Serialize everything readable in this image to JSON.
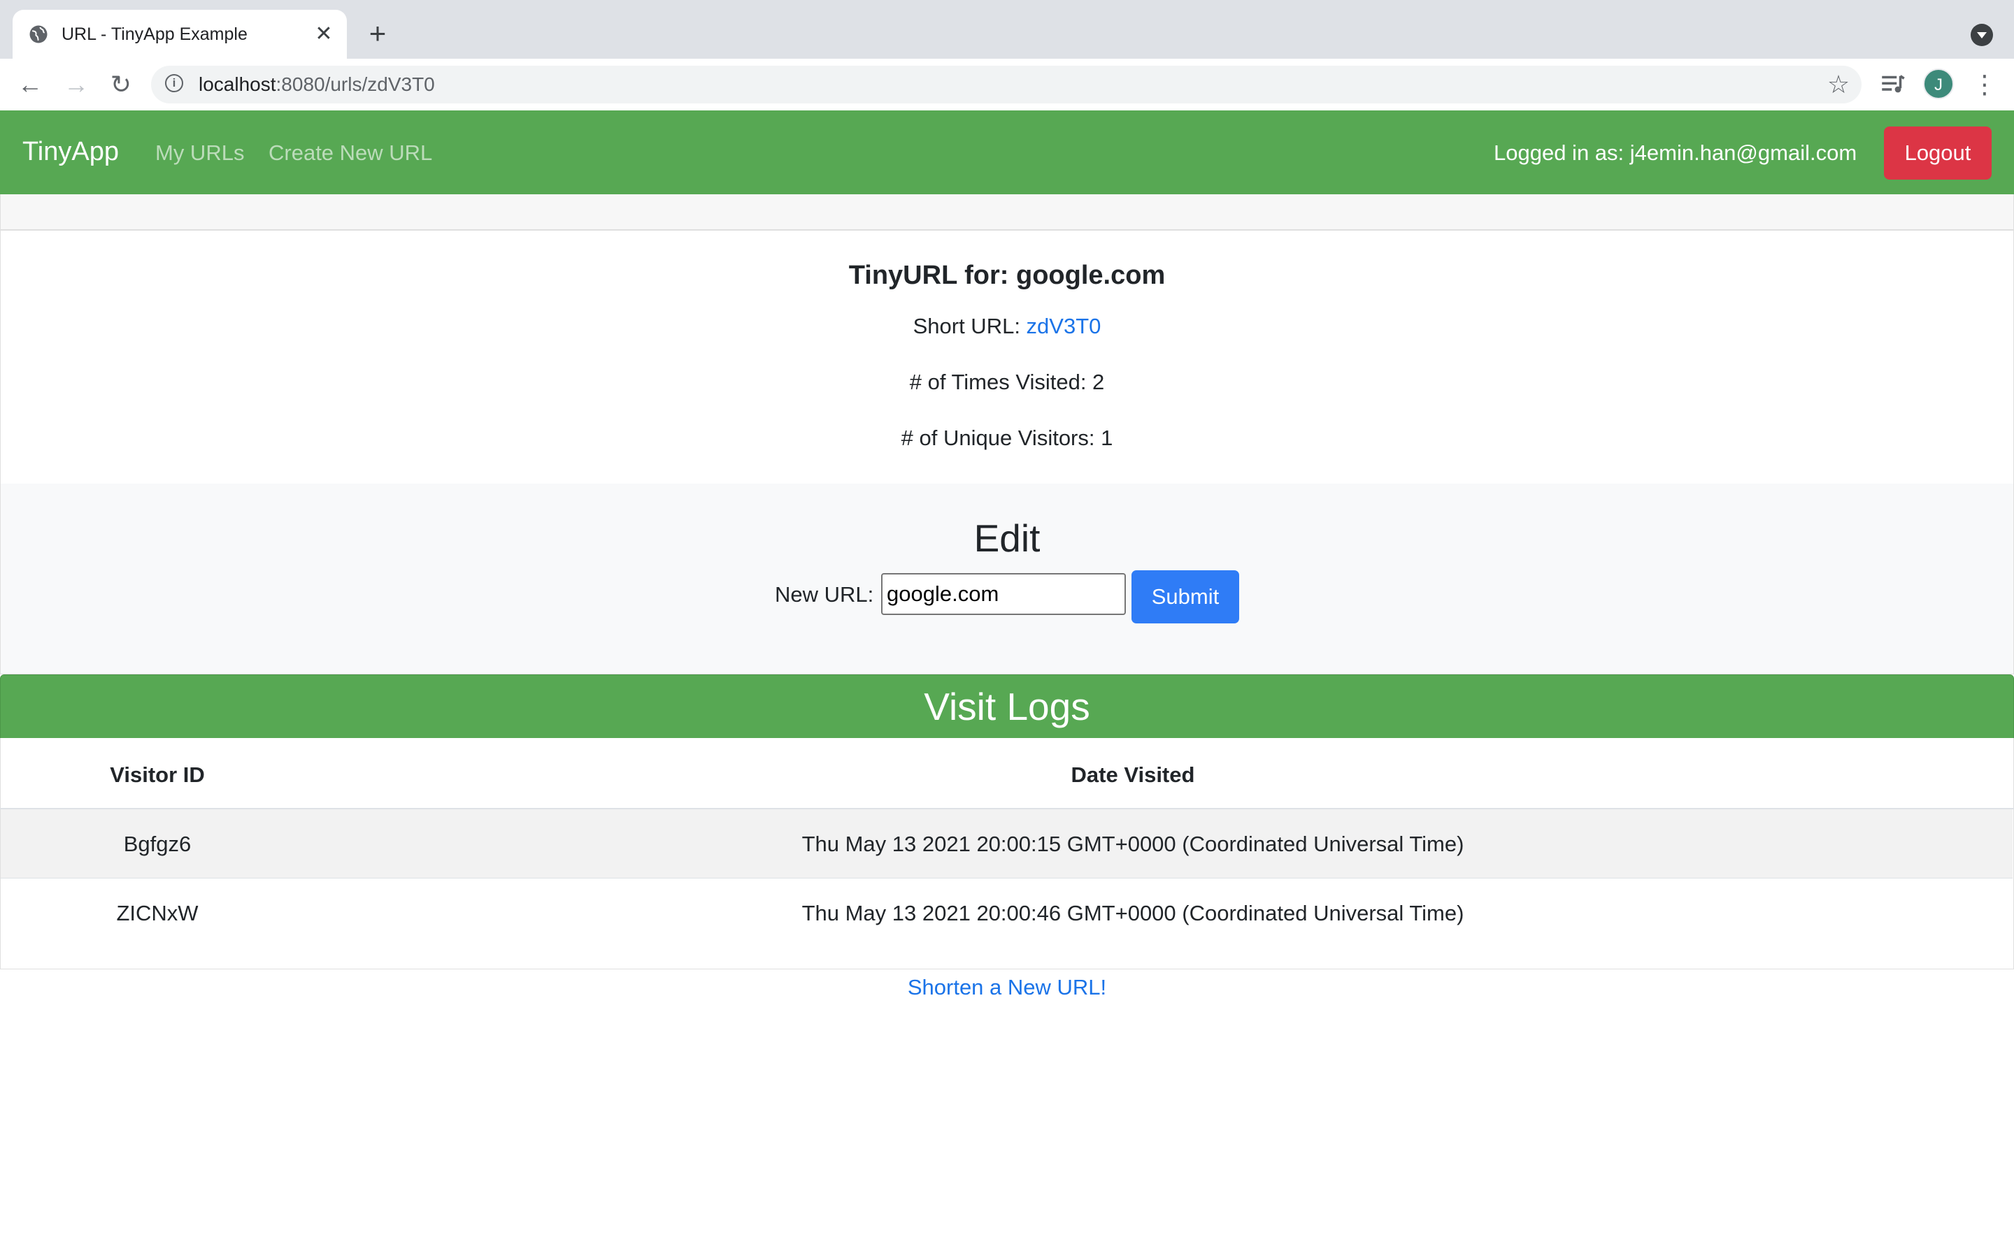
{
  "browser": {
    "tab_title": "URL - TinyApp Example",
    "url_host": "localhost",
    "url_rest": ":8080/urls/zdV3T0",
    "profile_initial": "J",
    "icons": {
      "tab_favicon": "globe-icon",
      "tab_close": "close-icon",
      "new_tab": "plus-icon",
      "back": "back-arrow-icon",
      "forward": "forward-arrow-icon",
      "reload": "reload-icon",
      "site_info": "info-icon",
      "bookmark": "star-icon",
      "media": "media-control-icon",
      "menu": "kebab-menu-icon",
      "tab_search": "tab-search-icon"
    }
  },
  "navbar": {
    "brand": "TinyApp",
    "links": [
      "My URLs",
      "Create New URL"
    ],
    "logged_in_text": "Logged in as: j4emin.han@gmail.com",
    "logout_label": "Logout",
    "colors": {
      "bar": "#57a853",
      "logout": "#dc3545"
    }
  },
  "url_info": {
    "title": "TinyURL for: google.com",
    "short_label": "Short URL: ",
    "short_code": "zdV3T0",
    "visits_text": "# of Times Visited: 2",
    "unique_text": "# of Unique Visitors: 1"
  },
  "edit": {
    "title": "Edit",
    "field_label": "New URL:",
    "field_value": "google.com",
    "submit_label": "Submit",
    "submit_color": "#2f7cf6"
  },
  "visit_logs": {
    "title": "Visit Logs",
    "columns": [
      "Visitor ID",
      "Date Visited"
    ],
    "rows": [
      {
        "visitor_id": "Bgfgz6",
        "date": "Thu May 13 2021 20:00:15 GMT+0000 (Coordinated Universal Time)"
      },
      {
        "visitor_id": "ZICNxW",
        "date": "Thu May 13 2021 20:00:46 GMT+0000 (Coordinated Universal Time)"
      }
    ]
  },
  "footer_link": "Shorten a New URL!"
}
